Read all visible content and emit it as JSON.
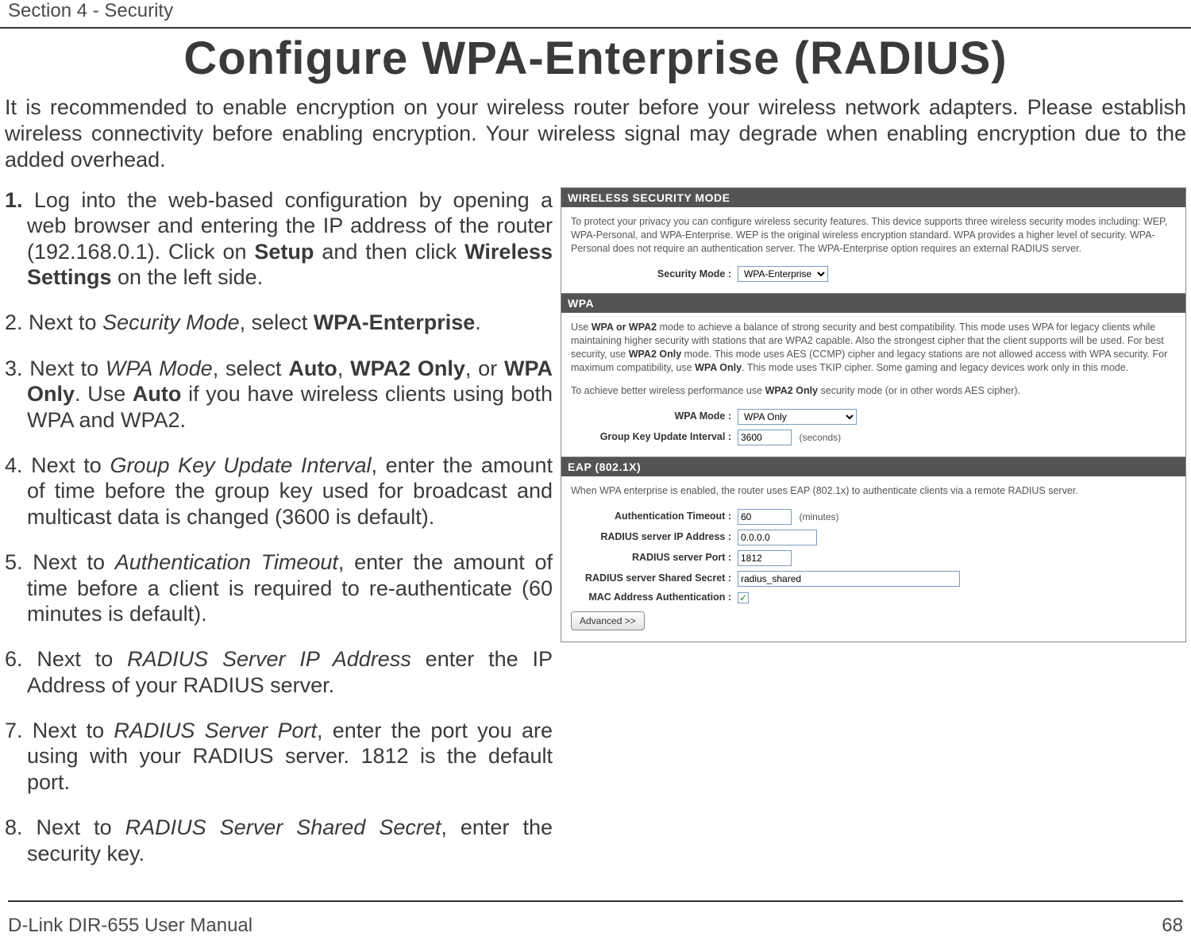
{
  "header": {
    "section_label": "Section 4 - Security"
  },
  "title": "Configure WPA-Enterprise (RADIUS)",
  "intro": "It is recommended to enable encryption on your wireless router before your wireless network adapters. Please establish wireless connectivity before enabling encryption. Your wireless signal may degrade when enabling encryption due to the added overhead.",
  "steps": [
    {
      "num": "1.",
      "pre": " Log into the web-based configuration by opening a web browser and entering the IP address of the router (192.168.0.1).  Click on ",
      "b1": "Setup",
      "mid": " and then click ",
      "b2": "Wireless Settings",
      "post": " on the left side."
    },
    {
      "num": "2.",
      "pre": " Next to ",
      "i1": "Security Mode",
      "mid": ", select ",
      "b1": "WPA-Enterprise",
      "post": "."
    },
    {
      "num": "3.",
      "pre": " Next to ",
      "i1": "WPA Mode",
      "mid": ", select ",
      "b1": "Auto",
      "mid2": ", ",
      "b2": "WPA2 Only",
      "mid3": ", or ",
      "b3": "WPA Only",
      "mid4": ". Use ",
      "b4": "Auto",
      "post": " if you have wireless clients using both WPA and WPA2."
    },
    {
      "num": "4.",
      "pre": " Next to ",
      "i1": "Group Key Update Interval",
      "post": ", enter the amount of time before the group key used for broadcast and multicast data is changed (3600 is default)."
    },
    {
      "num": "5.",
      "pre": " Next to ",
      "i1": "Authentication Timeout",
      "post": ", enter the amount of time before a client is required to re-authenticate (60 minutes is default)."
    },
    {
      "num": "6.",
      "pre": " Next to ",
      "i1": "RADIUS Server IP Address",
      "post": " enter the IP Address of your RADIUS server."
    },
    {
      "num": "7.",
      "pre": " Next to ",
      "i1": "RADIUS Server Port",
      "post": ", enter the port you are using with your RADIUS server. 1812 is the default port."
    },
    {
      "num": "8.",
      "pre": " Next to ",
      "i1": "RADIUS Server Shared Secret",
      "post": ", enter the security key."
    }
  ],
  "panel": {
    "wsm": {
      "title": "WIRELESS SECURITY MODE",
      "desc": "To protect your privacy you can configure wireless security features. This device supports three wireless security modes including: WEP, WPA-Personal, and WPA-Enterprise. WEP is the original wireless encryption standard. WPA provides a higher level of security. WPA-Personal does not require an authentication server. The WPA-Enterprise option requires an external RADIUS server.",
      "label": "Security Mode :",
      "value": "WPA-Enterprise"
    },
    "wpa": {
      "title": "WPA",
      "desc1_pre": "Use ",
      "desc1_b1": "WPA or WPA2",
      "desc1_mid": " mode to achieve a balance of strong security and best compatibility. This mode uses WPA for legacy clients while maintaining higher security with stations that are WPA2 capable. Also the strongest cipher that the client supports will be used. For best security, use ",
      "desc1_b2": "WPA2 Only",
      "desc1_mid2": " mode. This mode uses AES (CCMP) cipher and legacy stations are not allowed access with WPA security. For maximum compatibility, use ",
      "desc1_b3": "WPA Only",
      "desc1_post": ". This mode uses TKIP cipher. Some gaming and legacy devices work only in this mode.",
      "desc2_pre": "To achieve better wireless performance use ",
      "desc2_b": "WPA2 Only",
      "desc2_post": " security mode (or in other words AES cipher).",
      "mode_label": "WPA Mode :",
      "mode_value": "WPA Only",
      "interval_label": "Group Key Update Interval :",
      "interval_value": "3600",
      "interval_suffix": "(seconds)"
    },
    "eap": {
      "title": "EAP (802.1X)",
      "desc": "When WPA enterprise is enabled, the router uses EAP (802.1x) to authenticate clients via a remote RADIUS server.",
      "auth_label": "Authentication Timeout :",
      "auth_value": "60",
      "auth_suffix": "(minutes)",
      "ip_label": "RADIUS server IP Address :",
      "ip_value": "0.0.0.0",
      "port_label": "RADIUS server Port :",
      "port_value": "1812",
      "secret_label": "RADIUS server Shared Secret :",
      "secret_value": "radius_shared",
      "mac_label": "MAC Address Authentication :",
      "advanced_label": "Advanced >>"
    }
  },
  "footer": {
    "left": "D-Link DIR-655 User Manual",
    "right": "68"
  }
}
